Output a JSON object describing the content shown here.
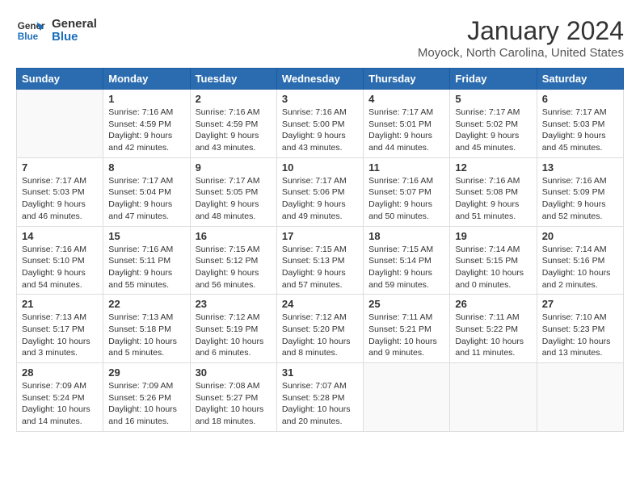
{
  "header": {
    "logo_line1": "General",
    "logo_line2": "Blue",
    "month": "January 2024",
    "location": "Moyock, North Carolina, United States"
  },
  "days_of_week": [
    "Sunday",
    "Monday",
    "Tuesday",
    "Wednesday",
    "Thursday",
    "Friday",
    "Saturday"
  ],
  "weeks": [
    [
      {
        "day": "",
        "info": ""
      },
      {
        "day": "1",
        "info": "Sunrise: 7:16 AM\nSunset: 4:59 PM\nDaylight: 9 hours\nand 42 minutes."
      },
      {
        "day": "2",
        "info": "Sunrise: 7:16 AM\nSunset: 4:59 PM\nDaylight: 9 hours\nand 43 minutes."
      },
      {
        "day": "3",
        "info": "Sunrise: 7:16 AM\nSunset: 5:00 PM\nDaylight: 9 hours\nand 43 minutes."
      },
      {
        "day": "4",
        "info": "Sunrise: 7:17 AM\nSunset: 5:01 PM\nDaylight: 9 hours\nand 44 minutes."
      },
      {
        "day": "5",
        "info": "Sunrise: 7:17 AM\nSunset: 5:02 PM\nDaylight: 9 hours\nand 45 minutes."
      },
      {
        "day": "6",
        "info": "Sunrise: 7:17 AM\nSunset: 5:03 PM\nDaylight: 9 hours\nand 45 minutes."
      }
    ],
    [
      {
        "day": "7",
        "info": "Sunrise: 7:17 AM\nSunset: 5:03 PM\nDaylight: 9 hours\nand 46 minutes."
      },
      {
        "day": "8",
        "info": "Sunrise: 7:17 AM\nSunset: 5:04 PM\nDaylight: 9 hours\nand 47 minutes."
      },
      {
        "day": "9",
        "info": "Sunrise: 7:17 AM\nSunset: 5:05 PM\nDaylight: 9 hours\nand 48 minutes."
      },
      {
        "day": "10",
        "info": "Sunrise: 7:17 AM\nSunset: 5:06 PM\nDaylight: 9 hours\nand 49 minutes."
      },
      {
        "day": "11",
        "info": "Sunrise: 7:16 AM\nSunset: 5:07 PM\nDaylight: 9 hours\nand 50 minutes."
      },
      {
        "day": "12",
        "info": "Sunrise: 7:16 AM\nSunset: 5:08 PM\nDaylight: 9 hours\nand 51 minutes."
      },
      {
        "day": "13",
        "info": "Sunrise: 7:16 AM\nSunset: 5:09 PM\nDaylight: 9 hours\nand 52 minutes."
      }
    ],
    [
      {
        "day": "14",
        "info": "Sunrise: 7:16 AM\nSunset: 5:10 PM\nDaylight: 9 hours\nand 54 minutes."
      },
      {
        "day": "15",
        "info": "Sunrise: 7:16 AM\nSunset: 5:11 PM\nDaylight: 9 hours\nand 55 minutes."
      },
      {
        "day": "16",
        "info": "Sunrise: 7:15 AM\nSunset: 5:12 PM\nDaylight: 9 hours\nand 56 minutes."
      },
      {
        "day": "17",
        "info": "Sunrise: 7:15 AM\nSunset: 5:13 PM\nDaylight: 9 hours\nand 57 minutes."
      },
      {
        "day": "18",
        "info": "Sunrise: 7:15 AM\nSunset: 5:14 PM\nDaylight: 9 hours\nand 59 minutes."
      },
      {
        "day": "19",
        "info": "Sunrise: 7:14 AM\nSunset: 5:15 PM\nDaylight: 10 hours\nand 0 minutes."
      },
      {
        "day": "20",
        "info": "Sunrise: 7:14 AM\nSunset: 5:16 PM\nDaylight: 10 hours\nand 2 minutes."
      }
    ],
    [
      {
        "day": "21",
        "info": "Sunrise: 7:13 AM\nSunset: 5:17 PM\nDaylight: 10 hours\nand 3 minutes."
      },
      {
        "day": "22",
        "info": "Sunrise: 7:13 AM\nSunset: 5:18 PM\nDaylight: 10 hours\nand 5 minutes."
      },
      {
        "day": "23",
        "info": "Sunrise: 7:12 AM\nSunset: 5:19 PM\nDaylight: 10 hours\nand 6 minutes."
      },
      {
        "day": "24",
        "info": "Sunrise: 7:12 AM\nSunset: 5:20 PM\nDaylight: 10 hours\nand 8 minutes."
      },
      {
        "day": "25",
        "info": "Sunrise: 7:11 AM\nSunset: 5:21 PM\nDaylight: 10 hours\nand 9 minutes."
      },
      {
        "day": "26",
        "info": "Sunrise: 7:11 AM\nSunset: 5:22 PM\nDaylight: 10 hours\nand 11 minutes."
      },
      {
        "day": "27",
        "info": "Sunrise: 7:10 AM\nSunset: 5:23 PM\nDaylight: 10 hours\nand 13 minutes."
      }
    ],
    [
      {
        "day": "28",
        "info": "Sunrise: 7:09 AM\nSunset: 5:24 PM\nDaylight: 10 hours\nand 14 minutes."
      },
      {
        "day": "29",
        "info": "Sunrise: 7:09 AM\nSunset: 5:26 PM\nDaylight: 10 hours\nand 16 minutes."
      },
      {
        "day": "30",
        "info": "Sunrise: 7:08 AM\nSunset: 5:27 PM\nDaylight: 10 hours\nand 18 minutes."
      },
      {
        "day": "31",
        "info": "Sunrise: 7:07 AM\nSunset: 5:28 PM\nDaylight: 10 hours\nand 20 minutes."
      },
      {
        "day": "",
        "info": ""
      },
      {
        "day": "",
        "info": ""
      },
      {
        "day": "",
        "info": ""
      }
    ]
  ]
}
